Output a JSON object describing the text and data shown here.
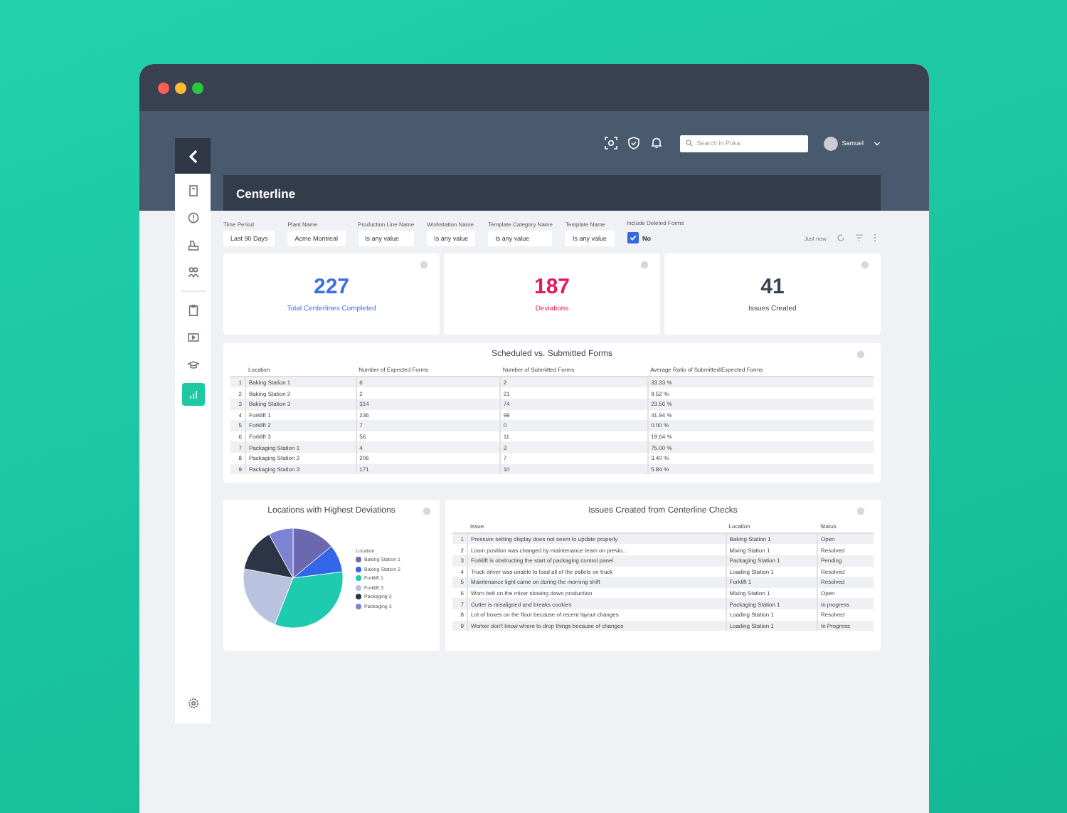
{
  "header": {
    "search": {
      "placeholder": "Search in Poka"
    },
    "user": "Samuel"
  },
  "sidebar": {
    "items": [
      {
        "kind": "book",
        "selected": false
      },
      {
        "kind": "alert",
        "selected": false
      },
      {
        "kind": "machine",
        "selected": false
      },
      {
        "kind": "people",
        "selected": false
      },
      {
        "kind": "clipboard",
        "selected": false
      },
      {
        "kind": "video",
        "selected": false
      },
      {
        "kind": "cap",
        "selected": false
      },
      {
        "kind": "chart",
        "selected": true
      }
    ]
  },
  "page": {
    "title": "Centerline"
  },
  "filters": [
    {
      "label": "Time Period",
      "value": "Last 90 Days"
    },
    {
      "label": "Plant Name",
      "value": "Acme Montreal"
    },
    {
      "label": "Production Line Name",
      "value": "Is any value"
    },
    {
      "label": "Workstation Name",
      "value": "Is any value"
    },
    {
      "label": "Template Category Name",
      "value": "Is any value"
    },
    {
      "label": "Template Name",
      "value": "Is any value"
    }
  ],
  "deleted_forms": {
    "label": "Include Deleted Forms",
    "checked": true,
    "value": "No"
  },
  "refresh": "Just now",
  "kpis": [
    {
      "value": "227",
      "label": "Total Centerlines Completed",
      "color": "#3d6fe0"
    },
    {
      "value": "187",
      "label": "Deviations",
      "color": "#e8185f"
    },
    {
      "value": "41",
      "label": "Issues Created",
      "color": "#3a4352"
    }
  ],
  "forms_table": {
    "title": "Scheduled vs. Submitted Forms",
    "columns": [
      "",
      "Location",
      "Number of Expected Forms",
      "Number of Submitted Forms",
      "Average Ratio of Submitted/Expected Forms"
    ],
    "rows": [
      [
        "1",
        "Baking Station 1",
        "6",
        "2",
        "33.33 %"
      ],
      [
        "2",
        "Baking Station 2",
        "2",
        "21",
        "9.52 %"
      ],
      [
        "3",
        "Baking Station 3",
        "314",
        "74",
        "23.56 %"
      ],
      [
        "4",
        "Forklift 1",
        "236",
        "99",
        "41.94 %"
      ],
      [
        "5",
        "Forklift 2",
        "7",
        "0",
        "0.00 %"
      ],
      [
        "6",
        "Forklift 3",
        "56",
        "11",
        "19.64 %"
      ],
      [
        "7",
        "Packaging Station 1",
        "4",
        "3",
        "75.00 %"
      ],
      [
        "8",
        "Packaging Station 2",
        "206",
        "7",
        "3.40 %"
      ],
      [
        "9",
        "Packaging Station 3",
        "171",
        "10",
        "5.84 %"
      ]
    ]
  },
  "pie": {
    "title": "Locations with Highest Deviations",
    "legend_title": "Location",
    "legend": [
      {
        "label": "Baking Station 1",
        "color": "#6b68b0"
      },
      {
        "label": "Baking Station 2",
        "color": "#3466ea"
      },
      {
        "label": "Forklift 1",
        "color": "#1ecbae"
      },
      {
        "label": "Forklift 3",
        "color": "#b9c3df"
      },
      {
        "label": "Packaging 2",
        "color": "#2c3445"
      },
      {
        "label": "Packaging 3",
        "color": "#7a84d3"
      }
    ]
  },
  "issues_table": {
    "title": "Issues Created from Centerline Checks",
    "columns": [
      "",
      "Issue",
      "Location",
      "Status"
    ],
    "rows": [
      [
        "1",
        "Pressure setting display does not seem to update properly",
        "Baking Station 1",
        "Open"
      ],
      [
        "2",
        "Loom position was changed by maintenance team on previo...",
        "Mixing Station 1",
        "Resolved"
      ],
      [
        "3",
        "Forklift is obstructing the start of packaging control panel",
        "Packaging Station 1",
        "Pending"
      ],
      [
        "4",
        "Truck driver was unable to load all of the pallets on truck",
        "Loading Station 1",
        "Resolved"
      ],
      [
        "5",
        "Maintenance light came on during the morning shift",
        "Forklift 1",
        "Resolved"
      ],
      [
        "6",
        "Worn belt on the mixer slowing down production",
        "Mixing Station 1",
        "Open"
      ],
      [
        "7",
        "Cutter is misaligned and breaks cookies",
        "Packaging Station 1",
        "In progress"
      ],
      [
        "8",
        "Lot of boxes on the floor because of recent layout changes",
        "Loading Station 1",
        "Resolved"
      ],
      [
        "9",
        "Worker don't know where to drop things because of changes",
        "Loading Station 1",
        "In Progress"
      ]
    ]
  }
}
